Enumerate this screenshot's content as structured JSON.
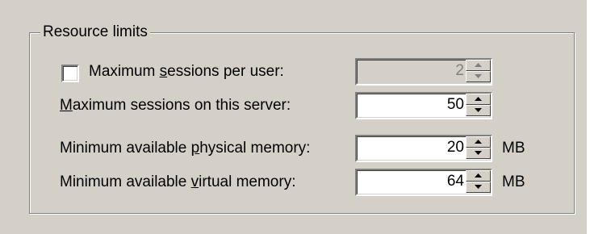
{
  "group": {
    "title": "Resource limits"
  },
  "rows": [
    {
      "label_pre": "Maximum ",
      "label_key": "s",
      "label_post": "essions per user:",
      "checked": false,
      "value": "2",
      "enabled": false,
      "unit": ""
    },
    {
      "label_pre": "",
      "label_key": "M",
      "label_post": "aximum sessions on this server:",
      "value": "50",
      "enabled": true,
      "unit": ""
    },
    {
      "label_pre": "Minimum available ",
      "label_key": "p",
      "label_post": "hysical memory:",
      "value": "20",
      "enabled": true,
      "unit": "MB"
    },
    {
      "label_pre": "Minimum available ",
      "label_key": "v",
      "label_post": "irtual memory:",
      "value": "64",
      "enabled": true,
      "unit": "MB"
    }
  ],
  "icons": {
    "spin_up": "spin-up-icon",
    "spin_down": "spin-down-icon"
  }
}
